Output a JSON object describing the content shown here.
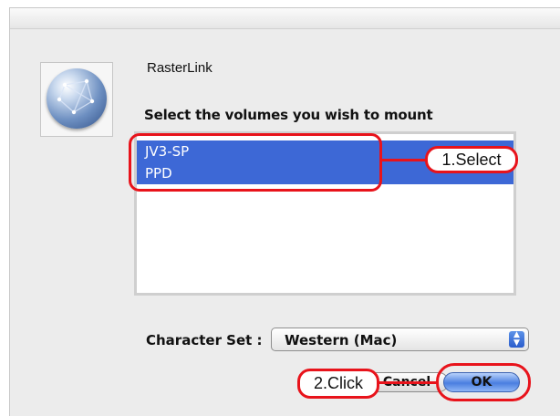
{
  "dialog": {
    "app_name": "RasterLink",
    "prompt": "Select the volumes you wish to mount",
    "volumes": [
      "JV3-SP",
      "PPD"
    ],
    "charset_label": "Character Set :",
    "charset_value": "Western (Mac)",
    "cancel_label": "Cancel",
    "ok_label": "OK",
    "app_icon": "network-globe-icon",
    "selection_color": "#3d68d6"
  },
  "annotations": {
    "step1": "1.Select",
    "step2": "2.Click",
    "color": "#e8131b"
  }
}
